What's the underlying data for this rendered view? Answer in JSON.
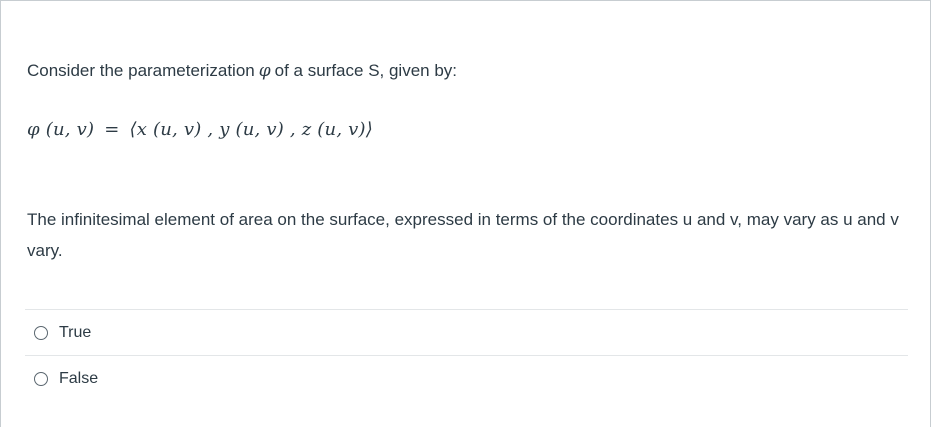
{
  "question": {
    "intro_before": "Consider the parameterization",
    "intro_symbol": "φ",
    "intro_after": "of a surface S, given by:",
    "formula_lhs": "φ (u, v)",
    "formula_eq": "=",
    "formula_rhs": "⟨x (u, v) , y (u, v) , z (u, v)⟩",
    "statement": "The infinitesimal element of area on the surface, expressed in terms of the coordinates u and v,  may vary as u and v vary."
  },
  "options": [
    {
      "label": "True",
      "selected": false
    },
    {
      "label": "False",
      "selected": false
    }
  ],
  "colors": {
    "text": "#2d3b45",
    "border": "#c7cdd1",
    "divider": "#e3e6e8"
  }
}
